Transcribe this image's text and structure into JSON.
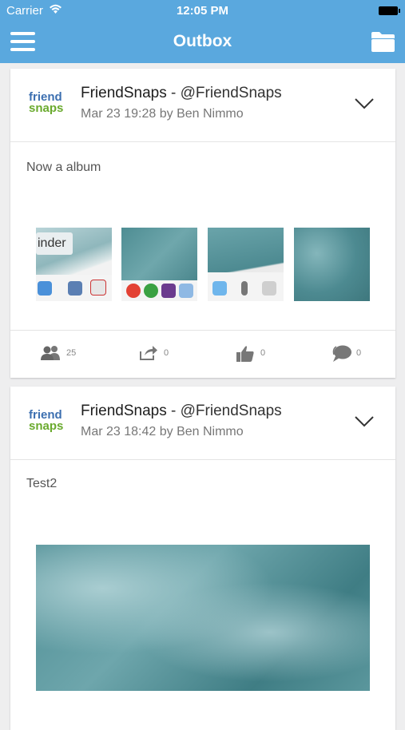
{
  "status_bar": {
    "carrier": "Carrier",
    "time": "12:05 PM"
  },
  "nav": {
    "title": "Outbox",
    "left_icon": "menu-icon",
    "right_icon": "folder-icon"
  },
  "colors": {
    "nav_bar": "#5aa8de",
    "logo_blue": "#3c6fb0",
    "logo_green": "#6aaa2e"
  },
  "posts": [
    {
      "logo": {
        "line1": "friend",
        "line2": "snaps"
      },
      "account_name": "FriendSnaps",
      "separator": " - ",
      "handle": "@FriendSnaps",
      "meta": "Mar 23 19:28 by Ben Nimmo",
      "text": "Now a album",
      "thumb_label": "inder",
      "actions": {
        "audience": "25",
        "shares": "0",
        "likes": "0",
        "comments": "0"
      }
    },
    {
      "logo": {
        "line1": "friend",
        "line2": "snaps"
      },
      "account_name": "FriendSnaps",
      "separator": " - ",
      "handle": "@FriendSnaps",
      "meta": "Mar 23 18:42 by Ben Nimmo",
      "text": "Test2"
    }
  ]
}
